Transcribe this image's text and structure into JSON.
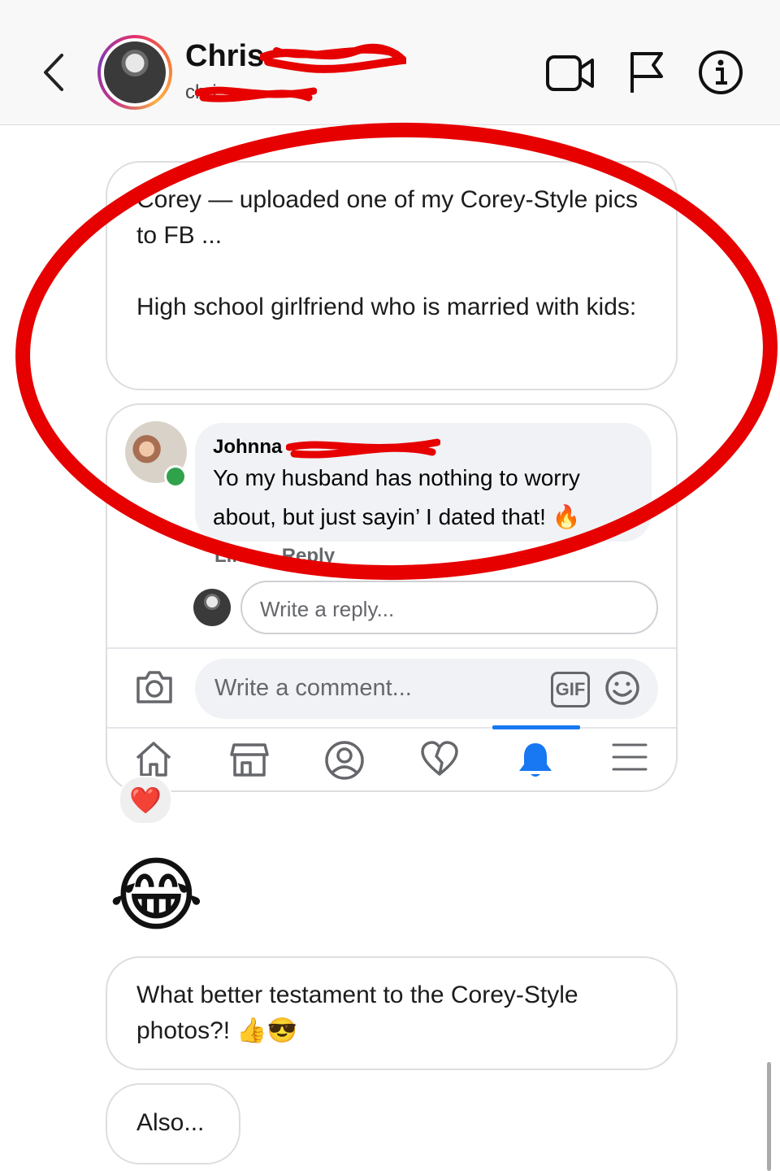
{
  "header": {
    "contact_name": "Chris",
    "username": "chri",
    "icons": [
      "back-chevron-icon",
      "video-call-icon",
      "flag-icon",
      "info-icon"
    ]
  },
  "messages": [
    {
      "text": "Corey — uploaded one of my Corey-Style pics to FB ...\n\nHigh school girlfriend who is married with kids:"
    },
    {
      "text": "What better testament to the Corey-Style photos?!  👍😎"
    },
    {
      "text": "Also..."
    }
  ],
  "embedded": {
    "comment_author": "Johnna",
    "comment_text": "Yo my husband has nothing to worry about,  but just sayin’ I dated that! 🔥",
    "actions": [
      "Like",
      "Reply"
    ],
    "reply_placeholder": "Write a reply...",
    "comment_placeholder": "Write a comment...",
    "gif_label": "GIF",
    "nav_icons": [
      "home-icon",
      "marketplace-icon",
      "profile-icon",
      "dating-heart-icon",
      "notifications-bell-icon",
      "menu-icon"
    ]
  },
  "reaction": "❤️",
  "emoji_message": "😂",
  "colors": {
    "annotation": "#e60000",
    "fb_blue": "#1877f2",
    "online": "#31a24c"
  }
}
